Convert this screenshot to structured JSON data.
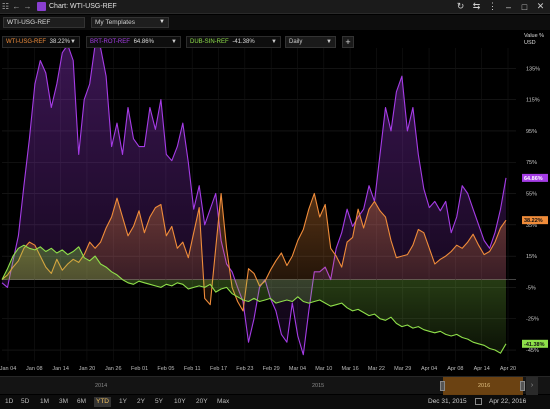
{
  "window": {
    "title": "Chart: WTI-USG-REF"
  },
  "toolbar": {
    "ticker_value": "WTI-USG-REF",
    "template_value": "My Templates"
  },
  "series_boxes": [
    {
      "name": "WTI-USG-REF",
      "value": "38.22%",
      "color": "#f0a050"
    },
    {
      "name": "BRT-ROT-REF",
      "value": "64.86%",
      "color": "#a040e0"
    },
    {
      "name": "DUB-SIN-REF",
      "value": "-41.38%",
      "color": "#90e040"
    }
  ],
  "interval": "Daily",
  "axis_header": [
    "Value %",
    "USD"
  ],
  "range_buttons": [
    "1D",
    "5D",
    "1M",
    "3M",
    "6M",
    "YTD",
    "1Y",
    "2Y",
    "5Y",
    "10Y",
    "20Y",
    "Max"
  ],
  "active_range": "YTD",
  "start_date": "Dec 31, 2015",
  "end_date": "Apr 22, 2016",
  "navigator_years": [
    "2014",
    "2015",
    "2016"
  ],
  "colors": {
    "orange": "#f08c3a",
    "purple": "#a53ce6",
    "green": "#8fe04a",
    "background": "#000000"
  },
  "chart_data": {
    "type": "line",
    "x": [
      "Jan 04",
      "Jan 08",
      "Jan 14",
      "Jan 20",
      "Jan 26",
      "Feb 01",
      "Feb 05",
      "Feb 11",
      "Feb 17",
      "Feb 23",
      "Feb 29",
      "Mar 04",
      "Mar 10",
      "Mar 16",
      "Mar 22",
      "Mar 29",
      "Apr 04",
      "Apr 08",
      "Apr 14",
      "Apr 20"
    ],
    "y_ticks": [
      135,
      115,
      95,
      75,
      55,
      35,
      15,
      -5,
      -25,
      -45
    ],
    "ylim": [
      -52,
      148
    ],
    "series": [
      {
        "name": "WTI-USG-REF",
        "color": "#f08c3a",
        "last_label": "38.22%",
        "values": [
          0,
          3,
          8,
          12,
          20,
          24,
          22,
          15,
          8,
          4,
          13,
          6,
          10,
          13,
          11,
          16,
          24,
          20,
          24,
          33,
          40,
          52,
          40,
          28,
          34,
          44,
          30,
          40,
          46,
          48,
          28,
          34,
          20,
          24,
          14,
          30,
          46,
          -12,
          -16,
          20,
          55,
          20,
          -5,
          -14,
          -20,
          7,
          4,
          -4,
          -1,
          6,
          12,
          17,
          9,
          15,
          25,
          32,
          45,
          55,
          40,
          48,
          20,
          15,
          8,
          24,
          27,
          45,
          33,
          45,
          50,
          44,
          40,
          25,
          14,
          15,
          16,
          22,
          32,
          30,
          20,
          10,
          13,
          15,
          18,
          22,
          20,
          24,
          29,
          22,
          16,
          18,
          24,
          33,
          38
        ]
      },
      {
        "name": "BRT-ROT-REF",
        "color": "#a53ce6",
        "last_label": "64.86%",
        "values": [
          -2,
          -5,
          12,
          28,
          60,
          90,
          125,
          140,
          132,
          110,
          125,
          145,
          150,
          140,
          80,
          115,
          125,
          150,
          148,
          130,
          85,
          100,
          80,
          110,
          90,
          85,
          85,
          110,
          96,
          115,
          80,
          76,
          85,
          100,
          75,
          45,
          60,
          35,
          45,
          55,
          25,
          10,
          5,
          -5,
          -14,
          -40,
          -25,
          -5,
          0,
          -12,
          -20,
          -35,
          -40,
          -15,
          -36,
          -48,
          -20,
          5,
          5,
          8,
          0,
          20,
          30,
          45,
          34,
          40,
          45,
          60,
          50,
          80,
          110,
          95,
          120,
          130,
          95,
          110,
          80,
          58,
          46,
          50,
          44,
          50,
          30,
          40,
          60,
          55,
          45,
          35,
          25,
          20,
          30,
          45,
          65
        ]
      },
      {
        "name": "DUB-SIN-REF",
        "color": "#8fe04a",
        "last_label": "-41.38%",
        "values": [
          0,
          7,
          15,
          20,
          22,
          20,
          19,
          21,
          18,
          20,
          17,
          19,
          16,
          18,
          21,
          14,
          12,
          15,
          10,
          8,
          5,
          3,
          0,
          -2,
          -3,
          -1,
          -2,
          -3,
          -4,
          -5,
          -3,
          -4,
          -2,
          -3,
          -6,
          -5,
          -4,
          -5,
          -3,
          -8,
          -6,
          -5,
          -9,
          -11,
          -13,
          -14,
          -12,
          -14,
          -13,
          -12,
          -15,
          -14,
          -13,
          -14,
          -11,
          -14,
          -15,
          -14,
          -13,
          -15,
          -17,
          -16,
          -15,
          -18,
          -20,
          -19,
          -21,
          -23,
          -22,
          -25,
          -26,
          -24,
          -28,
          -30,
          -29,
          -31,
          -30,
          -32,
          -33,
          -34,
          -33,
          -35,
          -36,
          -35,
          -37,
          -38,
          -40,
          -41,
          -42,
          -44,
          -45,
          -47,
          -41
        ]
      }
    ]
  }
}
